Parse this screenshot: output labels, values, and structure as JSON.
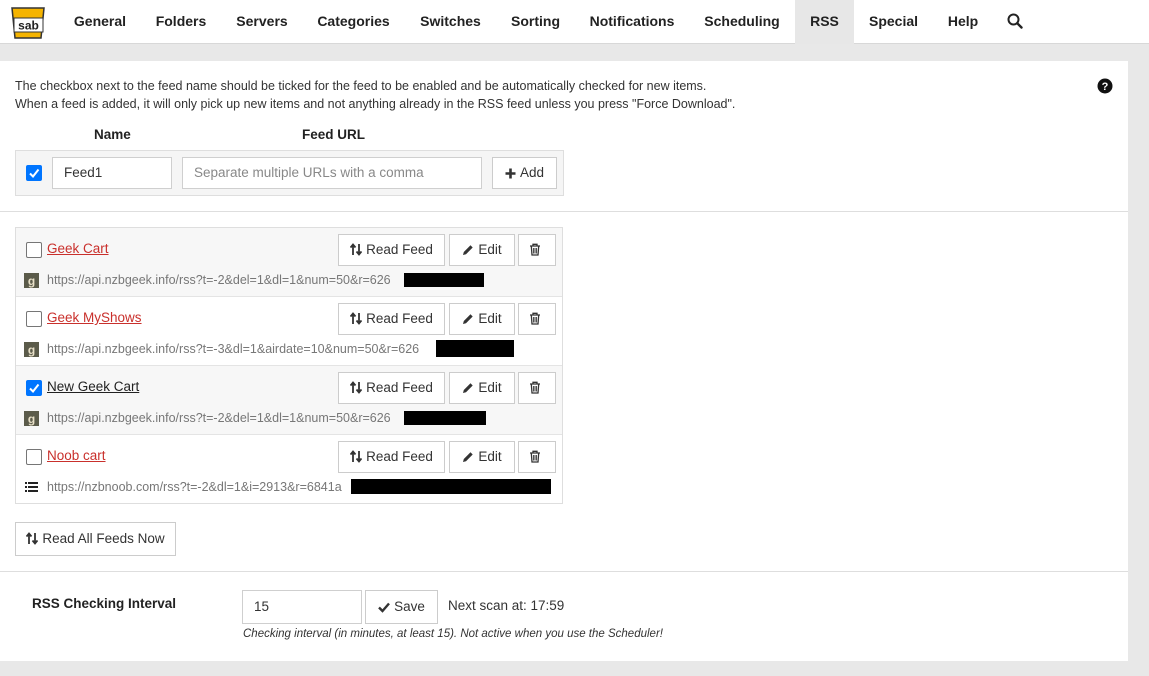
{
  "nav": {
    "items": [
      {
        "label": "General"
      },
      {
        "label": "Folders"
      },
      {
        "label": "Servers"
      },
      {
        "label": "Categories"
      },
      {
        "label": "Switches"
      },
      {
        "label": "Sorting"
      },
      {
        "label": "Notifications"
      },
      {
        "label": "Scheduling"
      },
      {
        "label": "RSS",
        "active": true
      },
      {
        "label": "Special"
      },
      {
        "label": "Help"
      }
    ],
    "logo_text": "sab"
  },
  "info": {
    "line1": "The checkbox next to the feed name should be ticked for the feed to be enabled and be automatically checked for new items.",
    "line2": "When a feed is added, it will only pick up new items and not anything already in the RSS feed unless you press \"Force Download\"."
  },
  "add_feed": {
    "name_header": "Name",
    "url_header": "Feed URL",
    "name_value": "Feed1",
    "enabled": true,
    "url_placeholder": "Separate multiple URLs with a comma",
    "add_label": "Add"
  },
  "feeds": [
    {
      "name": "Geek Cart",
      "enabled": false,
      "url": "https://api.nzbgeek.info/rss?t=-2&del=1&dl=1&num=50&r=626",
      "icon": "nzbgeek-icon"
    },
    {
      "name": "Geek MyShows",
      "enabled": false,
      "url": "https://api.nzbgeek.info/rss?t=-3&dl=1&airdate=10&num=50&r=626",
      "icon": "nzbgeek-icon"
    },
    {
      "name": "New Geek Cart",
      "enabled": true,
      "url": "https://api.nzbgeek.info/rss?t=-2&del=1&dl=1&num=50&r=626",
      "icon": "nzbgeek-icon"
    },
    {
      "name": "Noob cart",
      "enabled": false,
      "url": "https://nzbnoob.com/rss?t=-2&dl=1&i=2913&r=6841a",
      "icon": "list-icon"
    }
  ],
  "feed_buttons": {
    "read_feed": "Read Feed",
    "edit": "Edit"
  },
  "read_all_label": "Read All Feeds Now",
  "interval": {
    "label": "RSS Checking Interval",
    "value": "15",
    "save_label": "Save",
    "next_scan": "Next scan at: 17:59",
    "hint": "Checking interval (in minutes, at least 15). Not active when you use the Scheduler!"
  },
  "colors": {
    "disabled_feed": "#c9302c",
    "checkbox_on": "#0075ff",
    "active_tab_bg": "#e7e7e7"
  }
}
